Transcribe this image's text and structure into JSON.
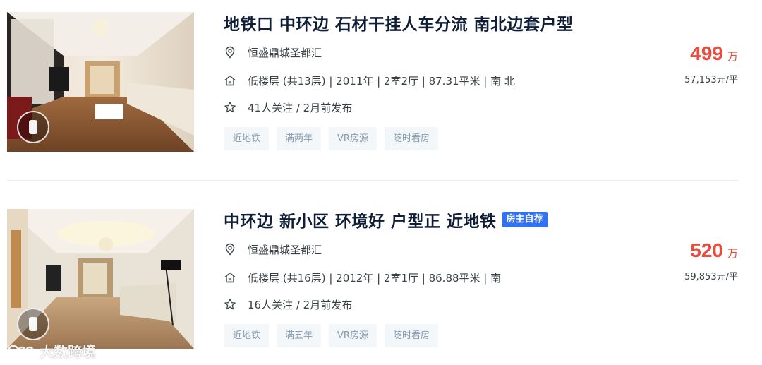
{
  "listings": [
    {
      "title": "地铁口 中环边 石材干挂人车分流 南北边套户型",
      "owner_tag": "",
      "location": "恒盛鼎城圣都汇",
      "house_info": "低楼层 (共13层) | 2011年 | 2室2厅 | 87.31平米 | 南 北",
      "follow_info": "41人关注 / 2月前发布",
      "tags": [
        "近地铁",
        "满两年",
        "VR房源",
        "随时看房"
      ],
      "price_total": "499",
      "price_total_unit": "万",
      "price_unit": "57,153元/平"
    },
    {
      "title": "中环边 新小区 环境好 户型正 近地铁",
      "owner_tag": "房主自荐",
      "location": "恒盛鼎城圣都汇",
      "house_info": "低楼层 (共16层) | 2012年 | 2室1厅 | 86.88平米 | 南",
      "follow_info": "16人关注 / 2月前发布",
      "tags": [
        "近地铁",
        "满五年",
        "VR房源",
        "随时看房"
      ],
      "price_total": "520",
      "price_total_unit": "万",
      "price_unit": "59,853元/平"
    }
  ],
  "watermark": {
    "text": "大数跨境"
  },
  "colors": {
    "price": "#e74c3c",
    "owner_tag_bg": "#3072f6",
    "tag_bg": "#f4f7f9",
    "tag_text": "#849aae",
    "title": "#101d37"
  },
  "icons": {
    "location": "location-pin-icon",
    "house": "house-icon",
    "follow": "star-icon"
  }
}
